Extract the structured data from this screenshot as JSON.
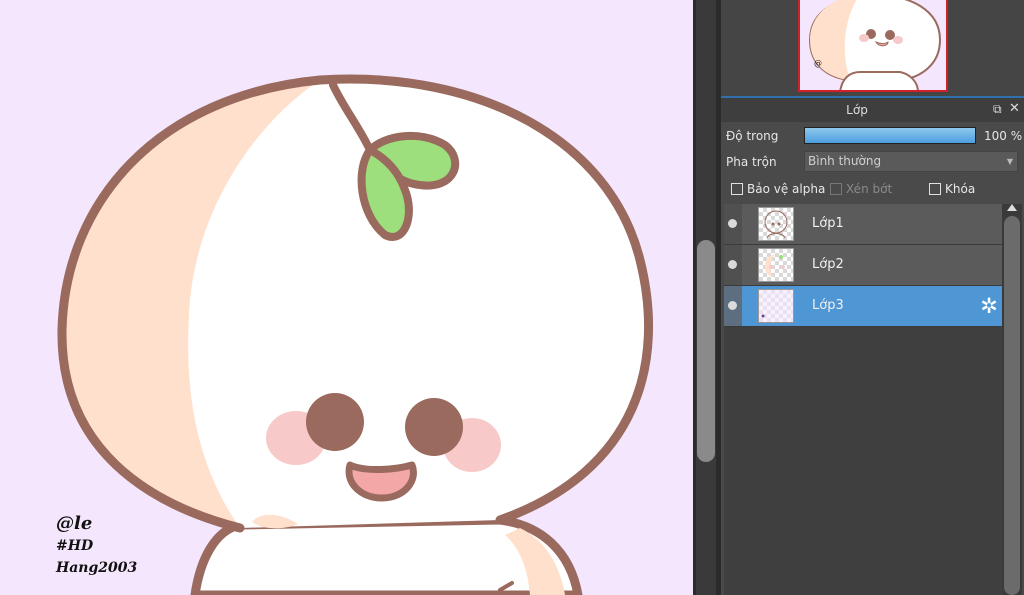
{
  "canvas": {
    "signature": [
      "@le",
      "#HD",
      "Hang2003"
    ]
  },
  "layer_panel": {
    "title": "Lớp",
    "opacity_label": "Độ trong",
    "opacity_value": "100 %",
    "opacity_fraction": 1.0,
    "blend_label": "Pha trộn",
    "blend_value": "Bình thường",
    "checkboxes": [
      {
        "label": "Bảo vệ alpha",
        "checked": false,
        "enabled": true
      },
      {
        "label": "Xén bớt",
        "checked": false,
        "enabled": false
      },
      {
        "label": "Khóa",
        "checked": false,
        "enabled": true
      }
    ],
    "layers": [
      {
        "name": "Lớp1",
        "selected": false,
        "visible": true
      },
      {
        "name": "Lớp2",
        "selected": false,
        "visible": true
      },
      {
        "name": "Lớp3",
        "selected": true,
        "visible": true
      }
    ]
  },
  "colors": {
    "canvas_bg": "#f4e6fd",
    "outline": "#9a6a5e",
    "peach": "#ffe0cc",
    "leaf": "#9ddf7c",
    "cheek": "#f8c9c9",
    "selection": "#4e97d4",
    "panel_bg": "#4a4a4a"
  }
}
